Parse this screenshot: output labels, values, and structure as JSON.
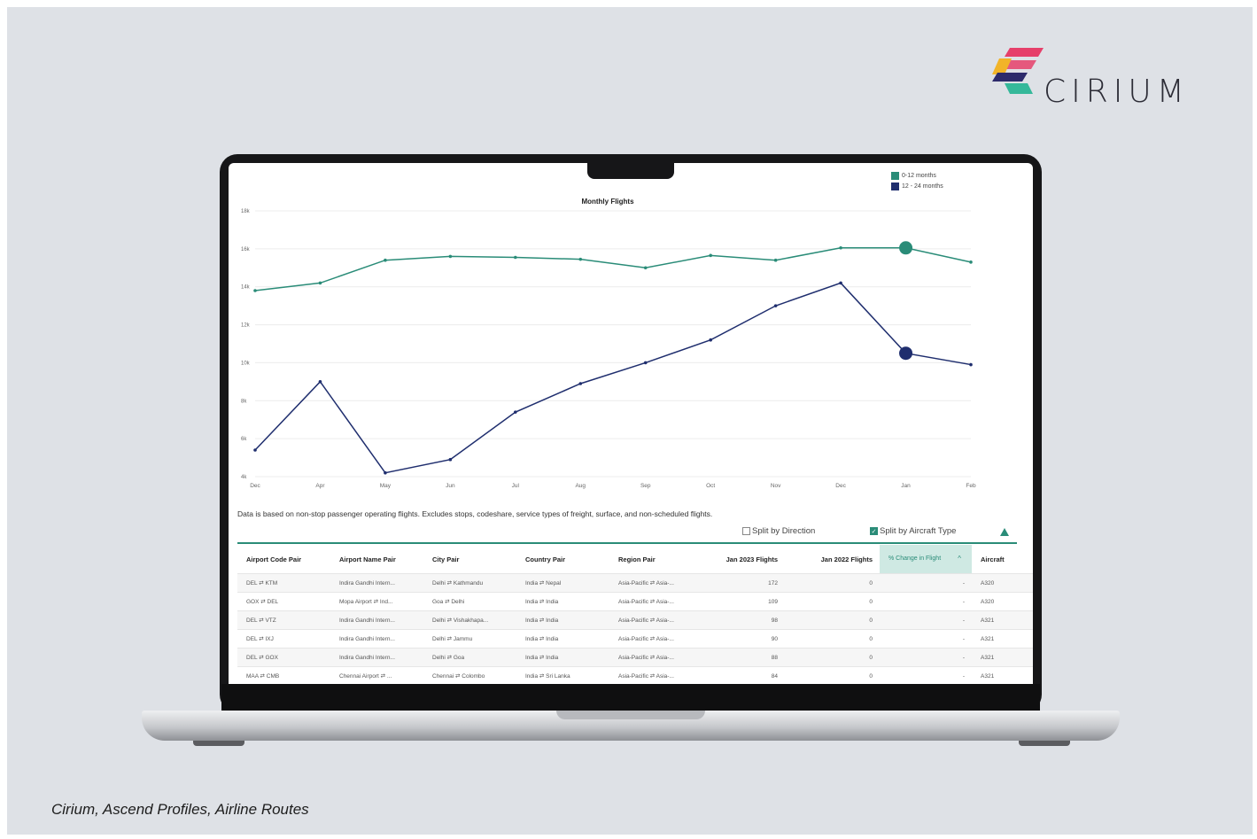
{
  "brand": {
    "name": "CIRIUM",
    "logo_colors": [
      "#e63f6a",
      "#f2b428",
      "#2d2a6b",
      "#35b89a"
    ]
  },
  "caption": "Cirium, Ascend Profiles, Airline Routes",
  "accent_color": "#2a8c78",
  "chart_data": {
    "type": "line",
    "title": "Monthly Flights",
    "categories": [
      "Dec",
      "Apr",
      "May",
      "Jun",
      "Jul",
      "Aug",
      "Sep",
      "Oct",
      "Nov",
      "Dec",
      "Jan",
      "Feb"
    ],
    "y_ticks": [
      "4k",
      "6k",
      "8k",
      "10k",
      "12k",
      "14k",
      "16k",
      "18k"
    ],
    "ylim": [
      4000,
      18000
    ],
    "grid": true,
    "legend_position": "top-right",
    "series": [
      {
        "name": "0-12 months",
        "color": "#2a8c78",
        "values": [
          13800,
          14200,
          15400,
          15600,
          15550,
          15450,
          15000,
          15650,
          15400,
          16050,
          16050,
          15300
        ],
        "highlight_index": 10
      },
      {
        "name": "12 - 24 months",
        "color": "#1f2e6e",
        "values": [
          5400,
          9000,
          4200,
          4900,
          7400,
          8900,
          10000,
          11200,
          13000,
          14200,
          10500,
          9900
        ],
        "highlight_index": 10
      }
    ]
  },
  "notes": {
    "data_basis": "Data is based on non-stop passenger operating flights. Excludes stops, codeshare, service types of freight, surface, and non-scheduled flights."
  },
  "toggles": {
    "split_direction": {
      "label": "Split by Direction",
      "checked": false
    },
    "split_aircraft": {
      "label": "Split by Aircraft Type",
      "checked": true
    }
  },
  "table": {
    "headers": [
      "Airport Code Pair",
      "Airport Name Pair",
      "City Pair",
      "Country Pair",
      "Region Pair",
      "Jan 2023 Flights",
      "Jan 2022 Flights",
      "% Change in Flight",
      "Aircraft"
    ],
    "rows": [
      [
        "DEL ⇄ KTM",
        "Indira Gandhi Intern...",
        "Delhi ⇄ Kathmandu",
        "India ⇄ Nepal",
        "Asia-Pacific ⇄ Asia-...",
        "172",
        "0",
        "-",
        "A320"
      ],
      [
        "GOX ⇄ DEL",
        "Mopa Airport ⇄ Ind...",
        "Goa ⇄ Delhi",
        "India ⇄ India",
        "Asia-Pacific ⇄ Asia-...",
        "109",
        "0",
        "-",
        "A320"
      ],
      [
        "DEL ⇄ VTZ",
        "Indira Gandhi Intern...",
        "Delhi ⇄ Vishakhapa...",
        "India ⇄ India",
        "Asia-Pacific ⇄ Asia-...",
        "98",
        "0",
        "-",
        "A321"
      ],
      [
        "DEL ⇄ IXJ",
        "Indira Gandhi Intern...",
        "Delhi ⇄ Jammu",
        "India ⇄ India",
        "Asia-Pacific ⇄ Asia-...",
        "90",
        "0",
        "-",
        "A321"
      ],
      [
        "DEL ⇄ GOX",
        "Indira Gandhi Intern...",
        "Delhi ⇄ Goa",
        "India ⇄ India",
        "Asia-Pacific ⇄ Asia-...",
        "88",
        "0",
        "-",
        "A321"
      ],
      [
        "MAA ⇄ CMB",
        "Chennai Airport ⇄ ...",
        "Chennai ⇄ Colombo",
        "India ⇄ Sri Lanka",
        "Asia-Pacific ⇄ Asia-...",
        "84",
        "0",
        "-",
        "A321"
      ]
    ]
  }
}
